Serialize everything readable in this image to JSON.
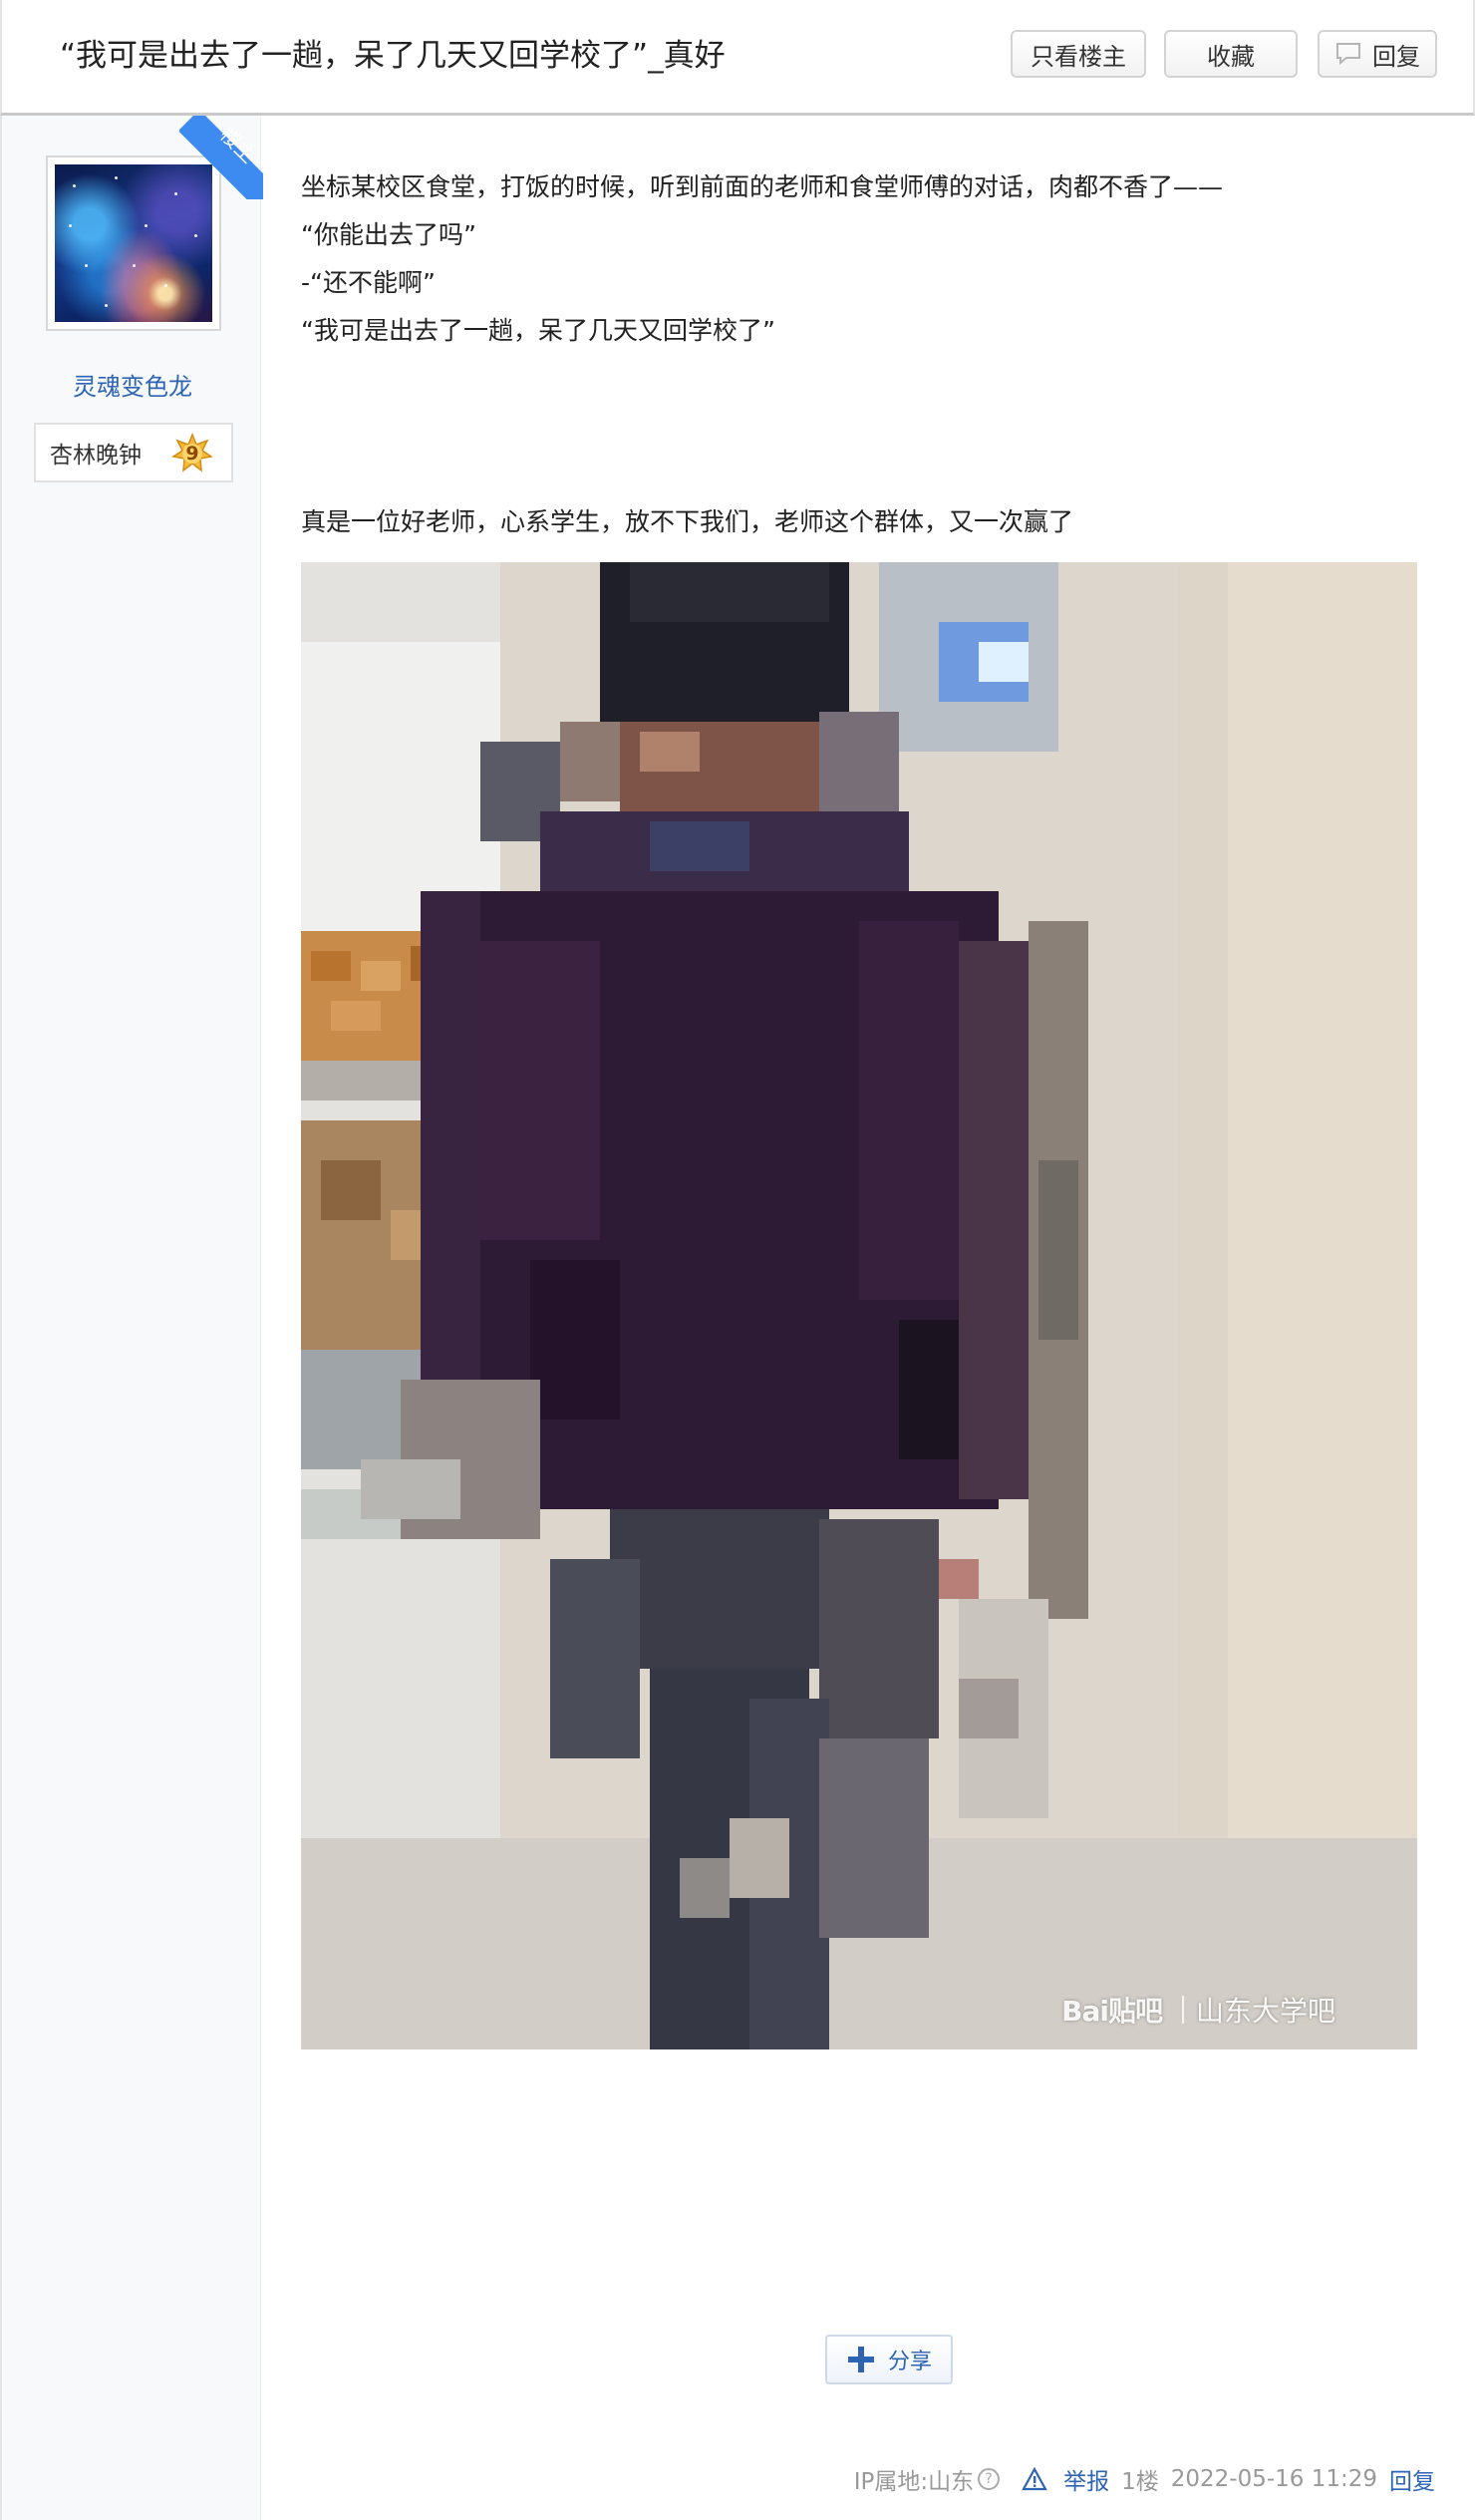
{
  "header": {
    "title": "“我可是出去了一趟，呆了几天又回学校了”_真好",
    "only_op_label": "只看楼主",
    "collect_label": "收藏",
    "reply_label": "回复"
  },
  "author": {
    "op_tag": "楼主",
    "name": "灵魂变色龙",
    "badge_name": "杏林晚钟",
    "level": "9"
  },
  "post": {
    "lines": [
      "坐标某校区食堂，打饭的时候，听到前面的老师和食堂师傅的对话，肉都不香了——",
      "“你能出去了吗”",
      "-“还不能啊”",
      "“我可是出去了一趟，呆了几天又回学校了”",
      "真是一位好老师，心系学生，放不下我们，老师这个群体，又一次赢了"
    ],
    "image_watermark": {
      "logo": "Bai贴吧",
      "text": "山东大学吧"
    }
  },
  "share_label": "分享",
  "footer": {
    "ip": "IP属地:山东",
    "report": "举报",
    "floor": "1楼",
    "timestamp": "2022-05-16 11:29",
    "reply": "回复"
  },
  "colors": {
    "link_blue": "#2d64b3",
    "op_ribbon": "#3d8bf0",
    "sidebar_bg": "#f8f9fb"
  }
}
